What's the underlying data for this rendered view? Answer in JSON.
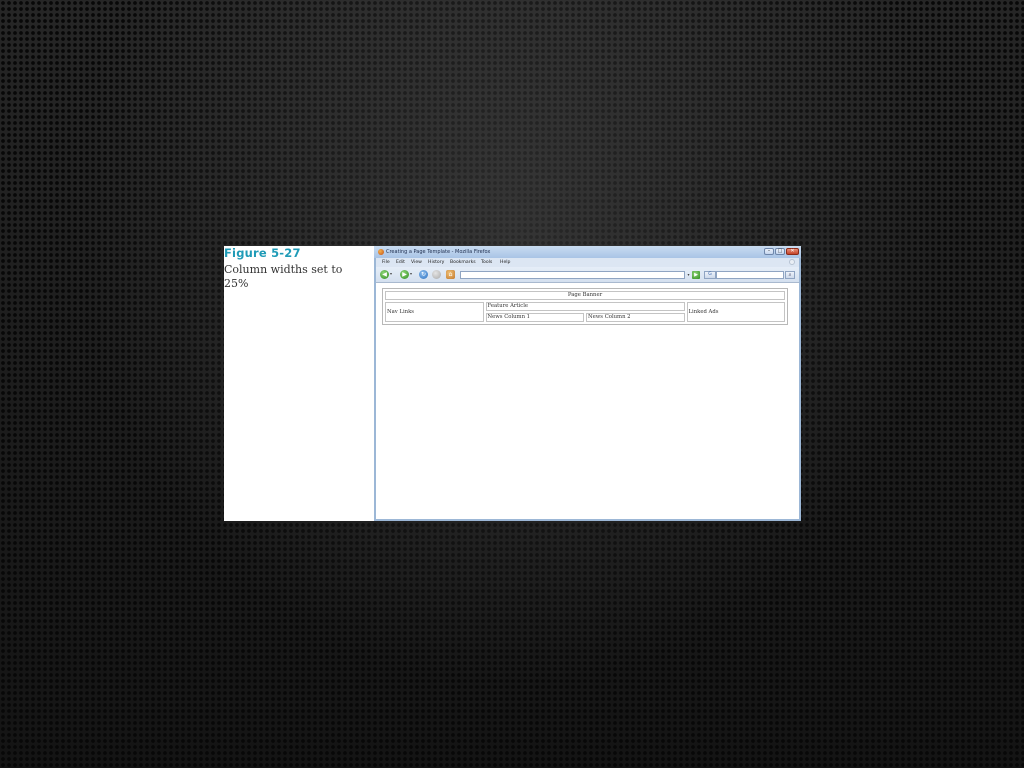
{
  "figure": {
    "number": "Figure 5-27",
    "caption": "Column widths set to 25%"
  },
  "browser": {
    "window_title": "Creating a Page Template - Mozilla Firefox",
    "window_buttons": [
      "–",
      "□",
      "✕"
    ],
    "menu": [
      "File",
      "Edit",
      "View",
      "History",
      "Bookmarks",
      "Tools",
      "Help"
    ],
    "address": "",
    "search_engine": "G"
  },
  "page_table": {
    "banner": "Page Banner",
    "nav_links": "Nav Links",
    "feature_article": "Feature Article",
    "news_column_1": "News Column 1",
    "news_column_2": "News Column 2",
    "linked_ads": "Linked Ads"
  },
  "colors": {
    "figure_number": "#1f9bb7",
    "titlebar": "#b9d0ec",
    "background": "#1e1e1e"
  }
}
